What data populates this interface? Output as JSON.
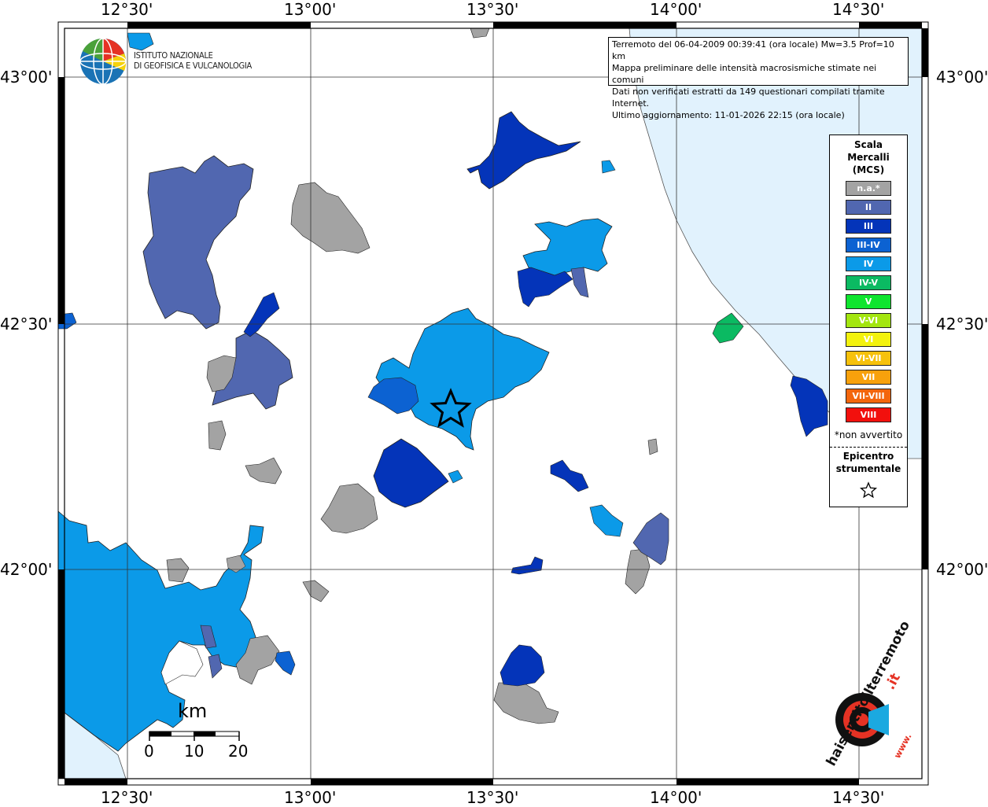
{
  "map": {
    "lon_labels": [
      "12°30'",
      "13°00'",
      "13°30'",
      "14°00'",
      "14°30'"
    ],
    "lat_labels": [
      "43°00'",
      "42°30'",
      "42°00'"
    ]
  },
  "info": {
    "line1": "Terremoto del 06-04-2009 00:39:41 (ora locale) Mw=3.5 Prof=10 km",
    "line2": "Mappa preliminare delle intensità macrosismiche stimate nei comuni",
    "line3": "Dati non verificati estratti da 149 questionari compilati tramite Internet.",
    "line4": "Ultimo aggiornamento: 11-01-2026 22:15 (ora locale)"
  },
  "logo": {
    "line1": "ISTITUTO NAZIONALE",
    "line2": "DI GEOFISICA E VULCANOLOGIA"
  },
  "legend": {
    "title1": "Scala",
    "title2": "Mercalli",
    "title3": "(MCS)",
    "items": [
      {
        "label": "n.a.*",
        "color": "#a3a3a3"
      },
      {
        "label": "II",
        "color": "#5167b0"
      },
      {
        "label": "III",
        "color": "#0434b9"
      },
      {
        "label": "III-IV",
        "color": "#0c62d2"
      },
      {
        "label": "IV",
        "color": "#0b9ae8"
      },
      {
        "label": "IV-V",
        "color": "#0bba62"
      },
      {
        "label": "V",
        "color": "#0ee52e"
      },
      {
        "label": "V-VI",
        "color": "#a3e60f"
      },
      {
        "label": "VI",
        "color": "#f3f20e"
      },
      {
        "label": "VI-VII",
        "color": "#f6c10c"
      },
      {
        "label": "VII",
        "color": "#f8a10c"
      },
      {
        "label": "VII-VIII",
        "color": "#f3660d"
      },
      {
        "label": "VIII",
        "color": "#f2100d"
      }
    ],
    "note": "*non avvertito",
    "epicenter1": "Epicentro",
    "epicenter2": "strumentale"
  },
  "scale": {
    "unit": "km",
    "ticks": [
      "0",
      "10",
      "20"
    ]
  },
  "watermark": {
    "text1": "haisentitoilterremoto",
    "text2": ".it",
    "text3": "www."
  }
}
